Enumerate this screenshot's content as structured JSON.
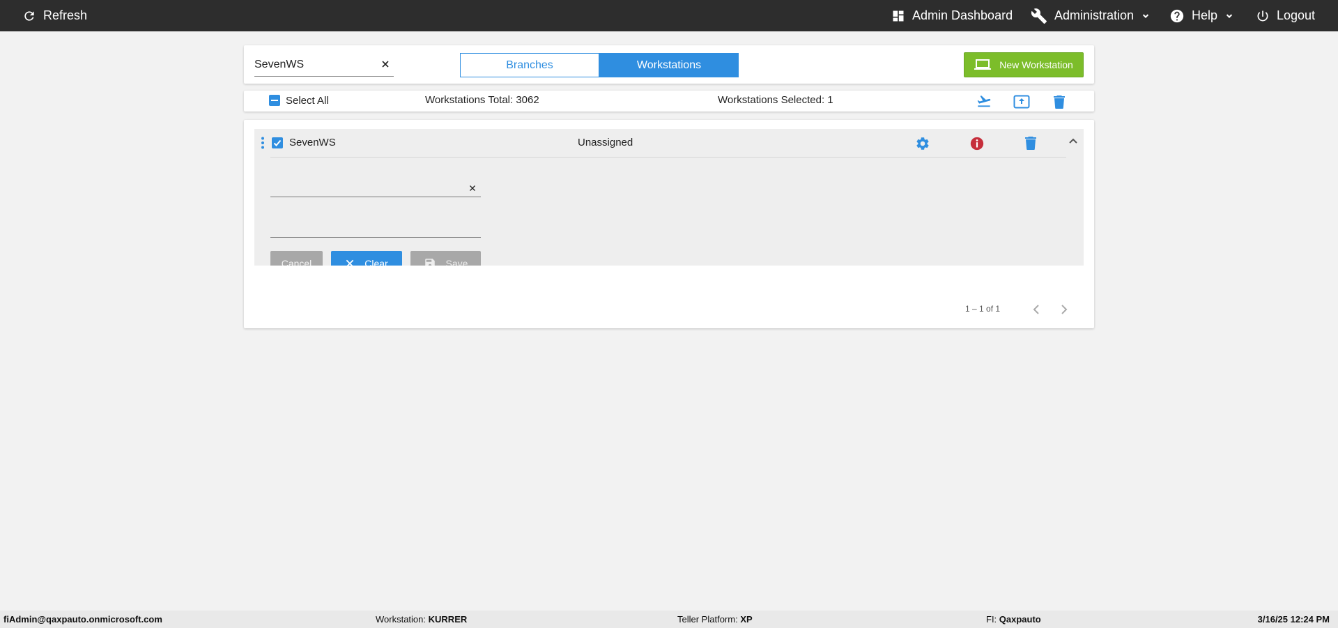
{
  "topbar": {
    "refresh": "Refresh",
    "admin_dashboard": "Admin Dashboard",
    "administration": "Administration",
    "help": "Help",
    "logout": "Logout"
  },
  "toolbar": {
    "search_value": "SevenWS",
    "tabs": [
      "Branches",
      "Workstations"
    ],
    "active_tab": "Workstations",
    "new_button": "New Workstation"
  },
  "selection_bar": {
    "select_all": "Select All",
    "total_label": "Workstations Total: 3062",
    "selected_label": "Workstations Selected: 1"
  },
  "list": {
    "items": [
      {
        "name": "SevenWS",
        "status": "Unassigned",
        "checked": true,
        "expanded": true
      }
    ]
  },
  "edit_form": {
    "field1_value": "",
    "field2_value": "",
    "cancel_label": "Cancel",
    "clear_label": "Clear",
    "save_label": "Save"
  },
  "pagination": {
    "range": "1 – 1 of 1"
  },
  "footer": {
    "user": "fiAdmin@qaxpauto.onmicrosoft.com",
    "workstation_label": "Workstation:",
    "workstation_value": "KURRER",
    "platform_label": "Teller Platform:",
    "platform_value": "XP",
    "fi_label": "FI:",
    "fi_value": "Qaxpauto",
    "datetime": "3/16/25 12:24 PM"
  },
  "colors": {
    "topbar": "#2d2d2d",
    "primary": "#2f8ee0",
    "success": "#7cbd2a",
    "danger": "#c62e3b",
    "disabled": "#a8a8a8"
  }
}
